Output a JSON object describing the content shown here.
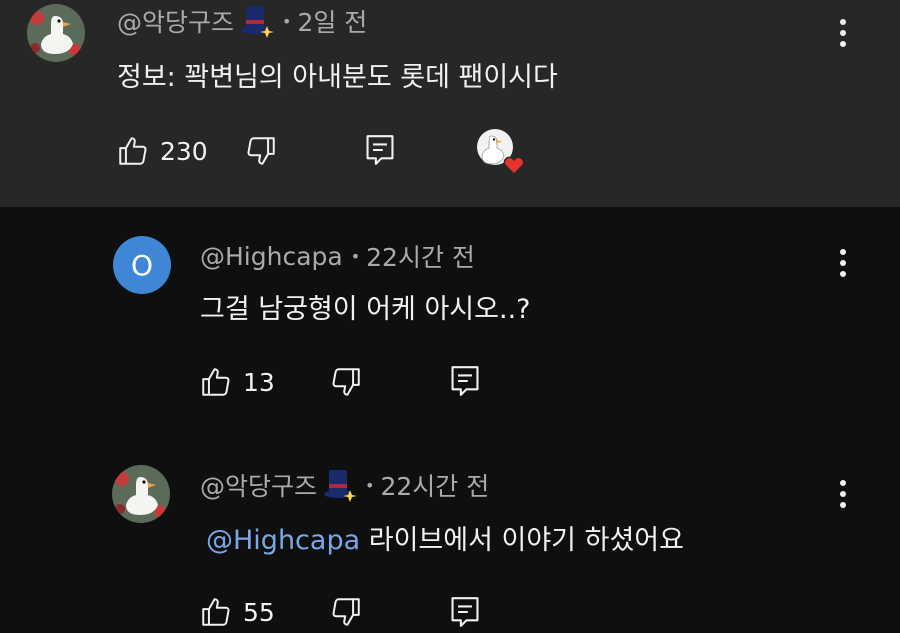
{
  "comments": [
    {
      "handle": "@악당구즈",
      "time": "2일 전",
      "text": "정보: 꽉변님의 아내분도 롯데 팬이시다",
      "likes": "230"
    },
    {
      "avatar_letter": "O",
      "handle": "@Highcapa",
      "time": "22시간 전",
      "text": "그걸 남궁형이 어케 아시오..?",
      "likes": "13"
    },
    {
      "handle": "@악당구즈",
      "time": "22시간 전",
      "mention": "@Highcapa",
      "text": " 라이브에서 이야기 하셨어요",
      "likes": "55"
    }
  ],
  "separator": "•",
  "icons": {
    "like": "thumbs-up-icon",
    "dislike": "thumbs-down-icon",
    "reply": "reply-icon",
    "more": "more-vertical-icon",
    "hat": "top-hat-icon",
    "heart": "creator-heart-icon"
  },
  "colors": {
    "background": "#0f0f0f",
    "highlight_background": "#272727",
    "mention": "#7aa7e6",
    "avatar_blue": "#3f87d6",
    "heart_red": "#e5322d"
  }
}
